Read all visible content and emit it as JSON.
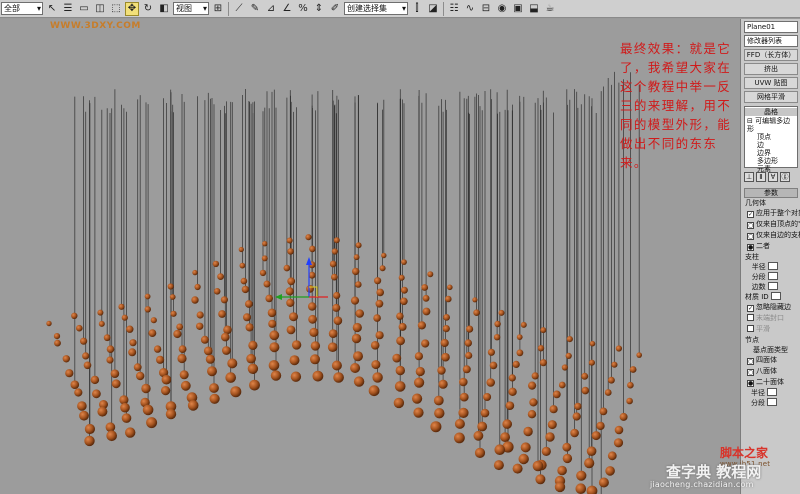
{
  "toolbar": {
    "selection_filter": "全部",
    "reference_coord": "视图",
    "named_selection": "创建选择集"
  },
  "viewport": {
    "watermark": "WWW.3DXY.COM",
    "annotation": "最终效果：就是它了，我希望大家在这个教程中举一反三的来理解，用不同的模型外形，能做出不同的东东来。"
  },
  "command_panel": {
    "object_name": "Plane01",
    "modifier_list": "修改器列表",
    "buttons": [
      "FFD（长方体）",
      "挤出",
      "UVW 贴图",
      "网格平滑",
      "编辑多边形"
    ],
    "stack": {
      "header": "晶格",
      "base_object": "可编辑多边形",
      "sub_objects": [
        "顶点",
        "边",
        "边界",
        "多边形",
        "元素"
      ]
    },
    "rollout_title": "参数",
    "geometry": {
      "title": "几何体",
      "apply_all": "应用于整个对象",
      "options": [
        "仅来自顶点的节点",
        "仅来自边的支柱",
        "二者"
      ]
    },
    "struts": {
      "title": "支柱",
      "fields": [
        "半径",
        "分段",
        "边数",
        "材质 ID"
      ],
      "checks": [
        "忽略隐藏边",
        "末端封口",
        "平滑"
      ]
    },
    "joints": {
      "title": "节点",
      "type_label": "基点面类型",
      "options": [
        "四面体",
        "八面体",
        "二十面体"
      ],
      "fields": [
        "半径",
        "分段"
      ]
    }
  },
  "logos": {
    "site_a": "脚本之家",
    "site_a_url": "www.jb51.net",
    "site_b": "查字典 教程网",
    "site_b_url": "jiaocheng.chazidian.com"
  },
  "colors": {
    "annotation": "#d01a1a",
    "sphere": "#a4531f",
    "wire": "#2d2d2d",
    "viewport_bg": "#9c9c9c"
  }
}
